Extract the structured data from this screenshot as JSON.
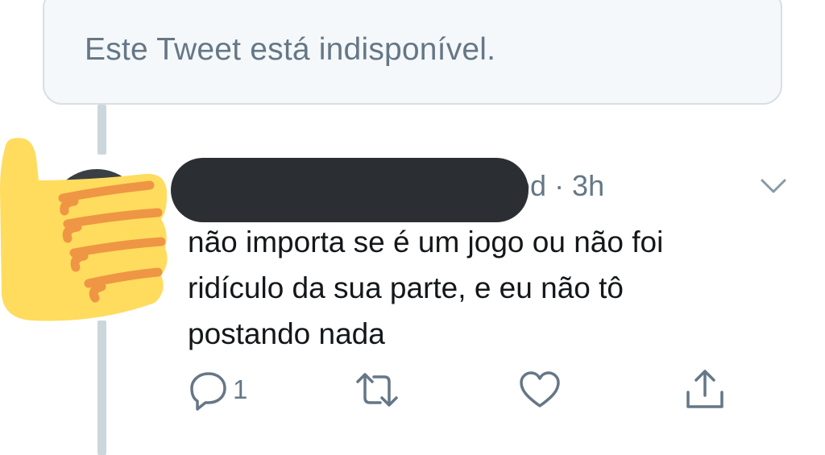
{
  "quoted": {
    "unavailable_text": "Este Tweet está indisponível."
  },
  "tweet": {
    "meta": "oved · 3h",
    "body_lines": [
      "não importa se é um jogo ou não foi",
      "ridículo da sua parte, e eu não tô",
      "postando nada"
    ],
    "reply_count": "1"
  },
  "icons": {
    "sticker": "thumbs-up-emoji",
    "menu": "chevron-down-icon",
    "reply": "reply-icon",
    "retweet": "retweet-icon",
    "like": "heart-icon",
    "share": "share-icon"
  },
  "colors": {
    "secondary_text": "#657786",
    "thread_line": "#ccd6dd",
    "box_border": "#d9dee3",
    "emoji_yellow": "#ffdc5d",
    "emoji_orange": "#ef9645",
    "redaction": "#2b2f33"
  }
}
